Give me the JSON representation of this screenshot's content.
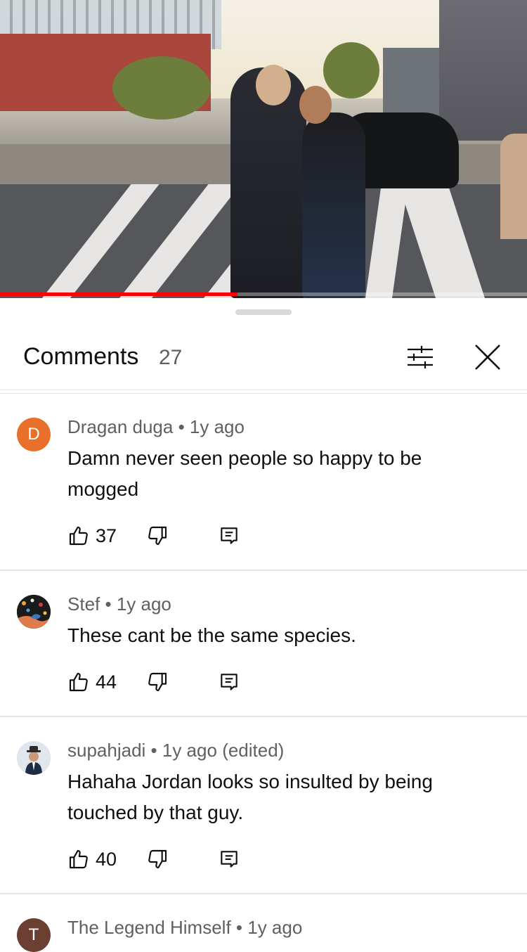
{
  "video": {
    "progress_percent": 45
  },
  "panel": {
    "title": "Comments",
    "count": "27",
    "sort_icon": "sort-filter-icon",
    "close_icon": "close-icon"
  },
  "comments": [
    {
      "author": "Dragan duga",
      "time": "1y ago",
      "edited": "",
      "text": "Damn never seen people so happy to be mogged",
      "likes": "37",
      "avatar_letter": "D",
      "avatar_color": "#e8702a"
    },
    {
      "author": "Stef",
      "time": "1y ago",
      "edited": "",
      "text": "These cant be the same species.",
      "likes": "44",
      "avatar_letter": "",
      "avatar_color": "#1b1b1b"
    },
    {
      "author": "supahjadi",
      "time": "1y ago",
      "edited": "(edited)",
      "text": "Hahaha Jordan looks so insulted by being touched by that guy.",
      "likes": "40",
      "avatar_letter": "",
      "avatar_color": "#cfd8e2"
    },
    {
      "author": "The Legend Himself",
      "time": "1y ago",
      "edited": "",
      "text": "",
      "likes": "",
      "avatar_letter": "T",
      "avatar_color": "#6b3f32"
    }
  ]
}
